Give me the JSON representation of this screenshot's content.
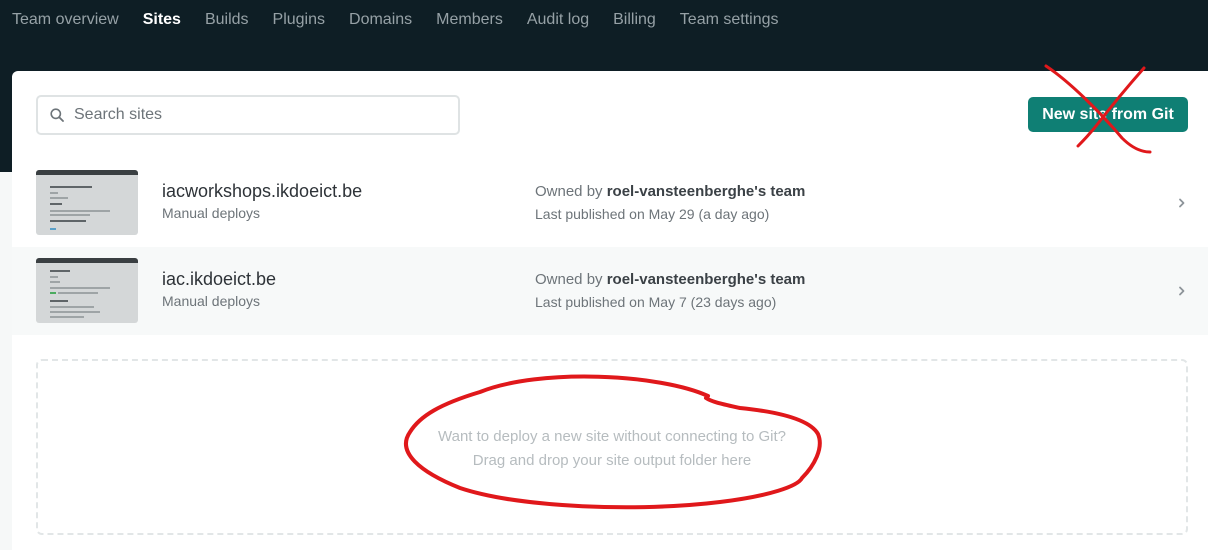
{
  "nav": {
    "tabs": [
      {
        "label": "Team overview",
        "active": false
      },
      {
        "label": "Sites",
        "active": true
      },
      {
        "label": "Builds",
        "active": false
      },
      {
        "label": "Plugins",
        "active": false
      },
      {
        "label": "Domains",
        "active": false
      },
      {
        "label": "Members",
        "active": false
      },
      {
        "label": "Audit log",
        "active": false
      },
      {
        "label": "Billing",
        "active": false
      },
      {
        "label": "Team settings",
        "active": false
      }
    ]
  },
  "search": {
    "placeholder": "Search sites",
    "icon": "search-icon"
  },
  "new_site_button": {
    "label": "New site from Git"
  },
  "sites": [
    {
      "name": "iacworkshops.ikdoeict.be",
      "deploy_type": "Manual deploys",
      "owner_prefix": "Owned by",
      "owner": "roel-vansteenberghe's team",
      "published": "Last published on May 29 (a day ago)"
    },
    {
      "name": "iac.ikdoeict.be",
      "deploy_type": "Manual deploys",
      "owner_prefix": "Owned by",
      "owner": "roel-vansteenberghe's team",
      "published": "Last published on May 7 (23 days ago)"
    }
  ],
  "dropzone": {
    "line1": "Want to deploy a new site without connecting to Git?",
    "line2": "Drag and drop your site output folder here"
  },
  "colors": {
    "nav_bg": "#0e1e25",
    "accent": "#0f7f74",
    "annotation": "#e0181b"
  }
}
